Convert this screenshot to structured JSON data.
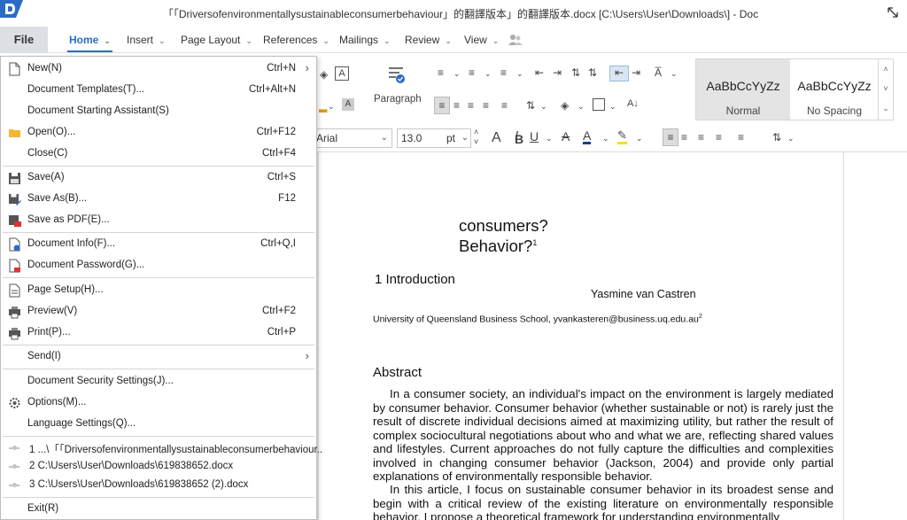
{
  "window": {
    "title": "「「Driversofenvironmentallysustainableconsumerbehaviour」的翻譯版本」的翻譯版本.docx [C:\\Users\\User\\Downloads\\] - Doc"
  },
  "tabs": {
    "file": "File",
    "home": "Home",
    "insert": "Insert",
    "page_layout": "Page Layout",
    "references": "References",
    "mailings": "Mailings",
    "review": "Review",
    "view": "View"
  },
  "ribbon": {
    "paragraph_label": "Paragraph",
    "font_name": "Arial",
    "font_size": "13.0",
    "font_size_unit": "pt",
    "styles": [
      {
        "sample": "AaBbCcYyZz",
        "name": "Normal"
      },
      {
        "sample": "AaBbCcYyZz",
        "name": "No Spacing"
      }
    ]
  },
  "file_menu": {
    "new": {
      "label": "New(N)",
      "shortcut": "Ctrl+N"
    },
    "templates": {
      "label": "Document Templates(T)...",
      "shortcut": "Ctrl+Alt+N"
    },
    "assistant": {
      "label": "Document Starting Assistant(S)"
    },
    "open": {
      "label": "Open(O)...",
      "shortcut": "Ctrl+F12"
    },
    "close": {
      "label": "Close(C)",
      "shortcut": "Ctrl+F4"
    },
    "save": {
      "label": "Save(A)",
      "shortcut": "Ctrl+S"
    },
    "save_as": {
      "label": "Save As(B)...",
      "shortcut": "F12"
    },
    "save_pdf": {
      "label": "Save as PDF(E)..."
    },
    "doc_info": {
      "label": "Document Info(F)...",
      "shortcut": "Ctrl+Q,I"
    },
    "doc_password": {
      "label": "Document Password(G)..."
    },
    "page_setup": {
      "label": "Page Setup(H)..."
    },
    "preview": {
      "label": "Preview(V)",
      "shortcut": "Ctrl+F2"
    },
    "print": {
      "label": "Print(P)...",
      "shortcut": "Ctrl+P"
    },
    "send": {
      "label": "Send(I)"
    },
    "security": {
      "label": "Document Security Settings(J)..."
    },
    "options": {
      "label": "Options(M)..."
    },
    "language": {
      "label": "Language Settings(Q)..."
    },
    "recent": [
      "1 ...\\「「Driversofenvironmentallysustainableconsumerbehaviour..",
      "2 C:\\Users\\User\\Downloads\\619838652.docx",
      "3 C:\\Users\\User\\Downloads\\619838652 (2).docx"
    ],
    "exit": {
      "label": "Exit(R)"
    }
  },
  "document": {
    "title_line1": "consumers?",
    "title_line2": "Behavior?",
    "title_footnote": "1",
    "section_heading": "1 Introduction",
    "author": "Yasmine van Castren",
    "affiliation": "University of Queensland Business School, yvankasteren@business.uq.edu.au",
    "affiliation_footnote": "2",
    "abstract_heading": "Abstract",
    "paragraph1": "In a consumer society, an individual's impact on the environment is largely mediated by consumer behavior. Consumer behavior (whether sustainable or not) is rarely just the result of discrete individual decisions aimed at maximizing utility, but rather the result of complex sociocultural negotiations about who and what we are, reflecting shared values and lifestyles. Current approaches do not fully capture the difficulties and complexities involved in changing consumer behavior (Jackson, 2004) and provide only partial explanations of environmentally responsible behavior.",
    "paragraph2": "In this article, I focus on sustainable consumer behavior in its broadest sense and begin with a critical review of the existing literature on environmentally responsible behavior. I propose a theoretical framework for understanding environmentally"
  }
}
